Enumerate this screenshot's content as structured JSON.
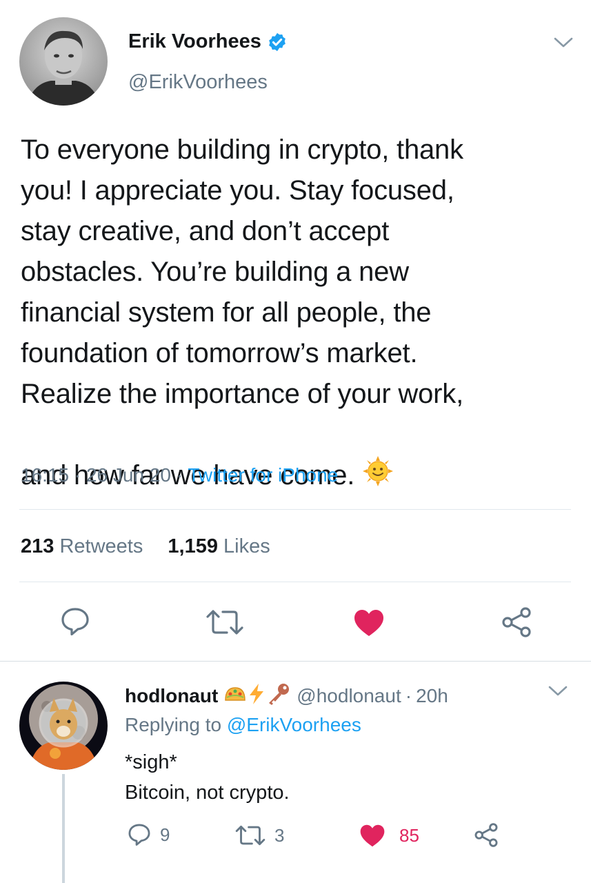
{
  "tweet": {
    "author_name": "Erik Voorhees",
    "author_handle": "@ErikVoorhees",
    "text": "To everyone building in crypto, thank\nyou! I appreciate you. Stay focused,\nstay creative, and don’t accept\nobstacles. You’re building a new\nfinancial system for all people, the\nfoundation of tomorrow’s market.\nRealize the importance of your work,\nand how far we have come.",
    "emoji": "🌞",
    "time": "16:15",
    "date": "26 Jun 20",
    "source": "Twitter for iPhone",
    "separator": "·",
    "retweets_count": "213",
    "retweets_label": "Retweets",
    "likes_count": "1,159",
    "likes_label": "Likes"
  },
  "reply": {
    "author_name": "hodlonaut",
    "author_handle": "@hodlonaut",
    "time_ago": "20h",
    "separator": "·",
    "replying_label": "Replying to",
    "replying_to": "@ErikVoorhees",
    "text": "*sigh*\nBitcoin, not crypto.",
    "reply_count": "9",
    "retweet_count": "3",
    "like_count": "85"
  },
  "colors": {
    "accent": "#1da1f2",
    "like": "#e0245e",
    "secondary_text": "#657786",
    "divider": "#e1e8ed"
  },
  "icons": [
    "verified-badge-icon",
    "chevron-down-icon",
    "reply-icon",
    "retweet-icon",
    "heart-icon",
    "share-icon",
    "taco-emoji-icon",
    "lightning-emoji-icon",
    "key-emoji-icon",
    "sun-emoji-icon"
  ]
}
